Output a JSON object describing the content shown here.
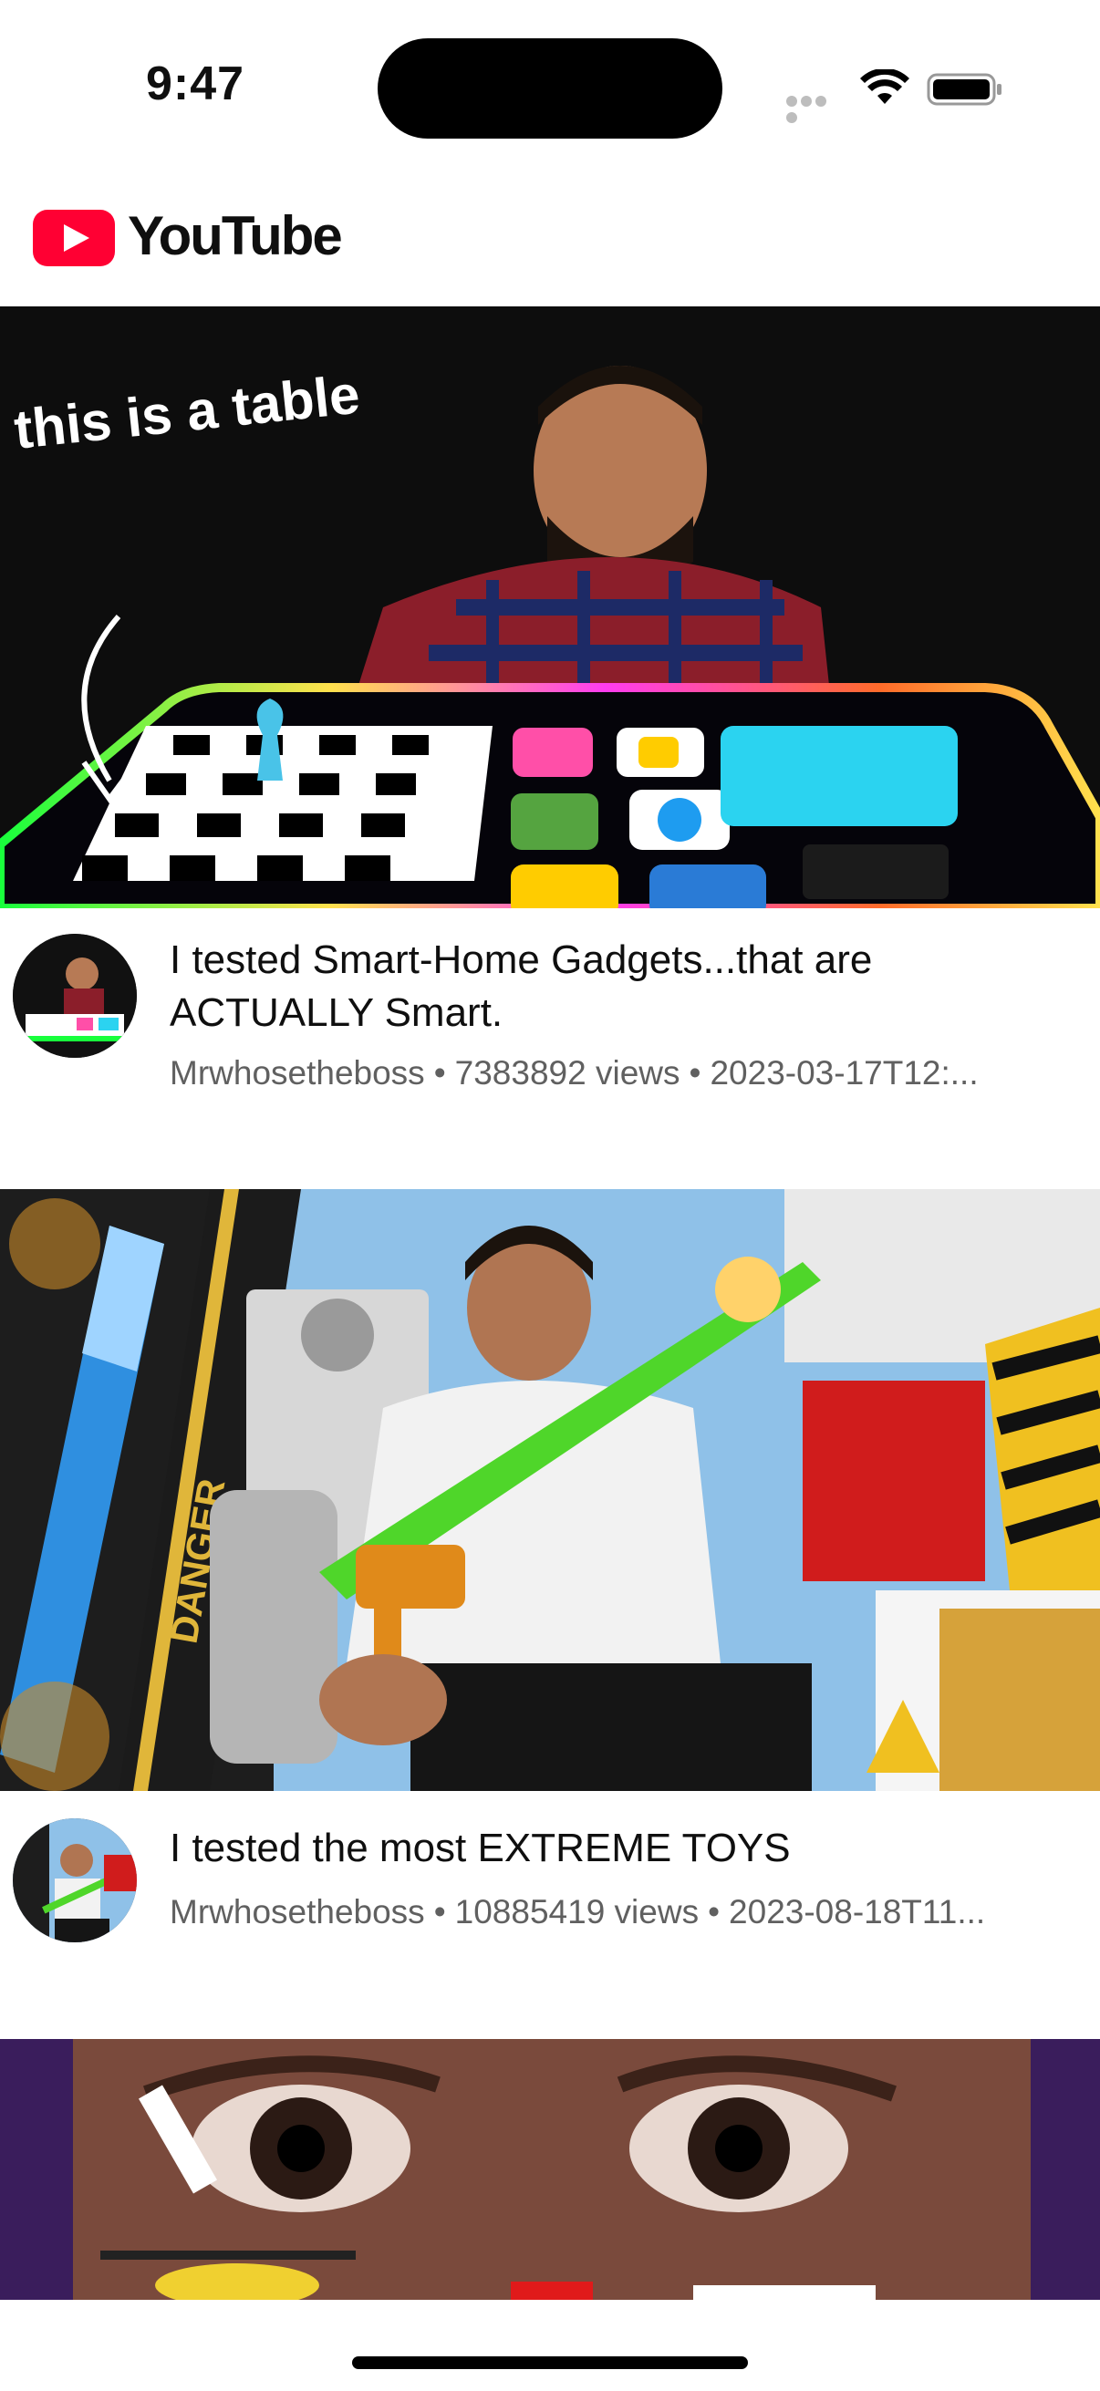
{
  "status_bar": {
    "time": "9:47"
  },
  "header": {
    "logo_text": "YouTube",
    "brand_color": "#FF0033"
  },
  "feed": {
    "videos": [
      {
        "title": "I tested Smart-Home Gadgets...that are ACTUALLY Smart.",
        "channel": "Mrwhosetheboss",
        "views": "7383892 views",
        "date": "2023-03-17T12:...",
        "thumbnail_text": "this is a table",
        "thumbnail_icon": "smart-table-thumbnail"
      },
      {
        "title": "I tested the most EXTREME TOYS",
        "channel": "Mrwhosetheboss",
        "views": "10885419 views",
        "date": "2023-08-18T11...",
        "thumbnail_text": "DANGER",
        "thumbnail_icon": "extreme-toys-thumbnail"
      },
      {
        "thumbnail_icon": "close-up-face-thumbnail"
      }
    ]
  },
  "separator": "•"
}
